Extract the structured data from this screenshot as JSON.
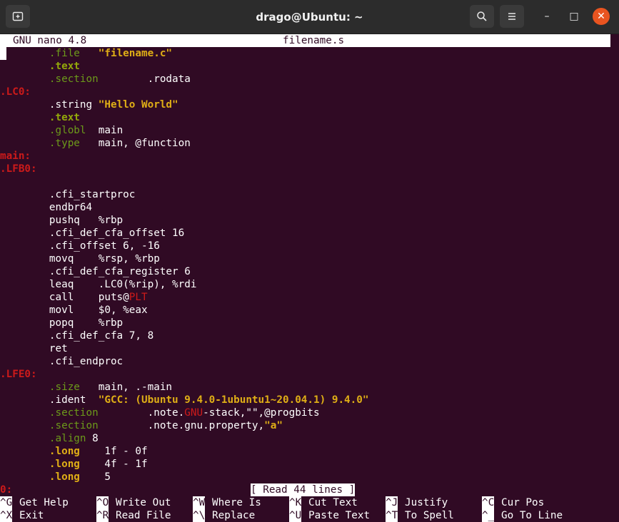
{
  "window": {
    "title": "drago@Ubuntu: ~",
    "new_tab_icon": "new-tab-icon",
    "search_icon": "search-icon",
    "menu_icon": "hamburger-menu-icon",
    "minimize": "–",
    "maximize": "□",
    "close": "✕"
  },
  "nano": {
    "version": "GNU nano 4.8",
    "filename": "filename.s",
    "status": "[ Read 44 lines ]"
  },
  "lines": [
    {
      "indent": "        ",
      "a": ".file",
      "a_cls": "g",
      "b": "   ",
      "c": "\"filename.c\"",
      "c_cls": "y"
    },
    {
      "indent": "        ",
      "a": ".text",
      "a_cls": "gb"
    },
    {
      "indent": "        ",
      "a": ".section",
      "a_cls": "g",
      "b": "        .rodata"
    },
    {
      "indent": "",
      "a": ".LC0:",
      "a_cls": "r"
    },
    {
      "indent": "        ",
      "a": ".string ",
      "a_cls": "w",
      "c": "\"Hello World\"",
      "c_cls": "y"
    },
    {
      "indent": "        ",
      "a": ".text",
      "a_cls": "gb"
    },
    {
      "indent": "        ",
      "a": ".globl",
      "a_cls": "g",
      "b": "  main"
    },
    {
      "indent": "        ",
      "a": ".type",
      "a_cls": "g",
      "b": "   main, @function"
    },
    {
      "indent": "",
      "a": "main:",
      "a_cls": "r"
    },
    {
      "indent": "",
      "a": ".LFB0:",
      "a_cls": "r"
    },
    {
      "indent": "",
      "a": ""
    },
    {
      "indent": "        ",
      "a": ".cfi_startproc",
      "a_cls": "w"
    },
    {
      "indent": "        ",
      "a": "endbr64",
      "a_cls": "w"
    },
    {
      "indent": "        ",
      "a": "pushq   %rbp",
      "a_cls": "w"
    },
    {
      "indent": "        ",
      "a": ".cfi_def_cfa_offset 16",
      "a_cls": "w"
    },
    {
      "indent": "        ",
      "a": ".cfi_offset 6, -16",
      "a_cls": "w"
    },
    {
      "indent": "        ",
      "a": "movq    %rsp, %rbp",
      "a_cls": "w"
    },
    {
      "indent": "        ",
      "a": ".cfi_def_cfa_register 6",
      "a_cls": "w"
    },
    {
      "indent": "        ",
      "a": "leaq    .LC0(%rip), %rdi",
      "a_cls": "w"
    },
    {
      "indent": "        ",
      "a": "call    puts@",
      "a_cls": "w",
      "c": "PLT",
      "c_cls": "rn"
    },
    {
      "indent": "        ",
      "a": "movl    $0, %eax",
      "a_cls": "w"
    },
    {
      "indent": "        ",
      "a": "popq    %rbp",
      "a_cls": "w"
    },
    {
      "indent": "        ",
      "a": ".cfi_def_cfa 7, 8",
      "a_cls": "w"
    },
    {
      "indent": "        ",
      "a": "ret",
      "a_cls": "w"
    },
    {
      "indent": "        ",
      "a": ".cfi_endproc",
      "a_cls": "w"
    },
    {
      "indent": "",
      "a": ".LFE0:",
      "a_cls": "r"
    },
    {
      "indent": "        ",
      "a": ".size",
      "a_cls": "g",
      "b": "   main, .-main"
    },
    {
      "indent": "        ",
      "a": ".ident  ",
      "a_cls": "w",
      "c": "\"GCC: (Ubuntu 9.4.0-1ubuntu1~20.04.1) 9.4.0\"",
      "c_cls": "y"
    },
    {
      "indent": "        ",
      "a": ".section",
      "a_cls": "g",
      "b": "        .note.",
      "c": "GNU",
      "c_cls": "rn",
      "d": "-stack,\"\",@progbits"
    },
    {
      "indent": "        ",
      "a": ".section",
      "a_cls": "g",
      "b": "        .note.gnu.property,",
      "c": "\"a\"",
      "c_cls": "y"
    },
    {
      "indent": "        ",
      "a": ".align",
      "a_cls": "g",
      "b": " 8"
    },
    {
      "indent": "        ",
      "a": ".long",
      "a_cls": "y",
      "b": "    1f - 0f"
    },
    {
      "indent": "        ",
      "a": ".long",
      "a_cls": "y",
      "b": "    4f - 1f"
    },
    {
      "indent": "        ",
      "a": ".long",
      "a_cls": "y",
      "b": "    5"
    },
    {
      "indent": "",
      "a": "0:",
      "a_cls": "r"
    }
  ],
  "shortcuts": [
    [
      {
        "key": "^G",
        "label": "Get Help"
      },
      {
        "key": "^O",
        "label": "Write Out"
      },
      {
        "key": "^W",
        "label": "Where Is"
      },
      {
        "key": "^K",
        "label": "Cut Text"
      },
      {
        "key": "^J",
        "label": "Justify"
      },
      {
        "key": "^C",
        "label": "Cur Pos"
      }
    ],
    [
      {
        "key": "^X",
        "label": "Exit"
      },
      {
        "key": "^R",
        "label": "Read File"
      },
      {
        "key": "^\\",
        "label": "Replace"
      },
      {
        "key": "^U",
        "label": "Paste Text"
      },
      {
        "key": "^T",
        "label": "To Spell"
      },
      {
        "key": "^_",
        "label": "Go To Line"
      }
    ]
  ],
  "colors": {
    "background": "#300a24",
    "directive_green": "#6c9a1a",
    "string_yellow": "#dfae16",
    "label_red": "#cc1a1a",
    "close_button": "#e95420"
  }
}
